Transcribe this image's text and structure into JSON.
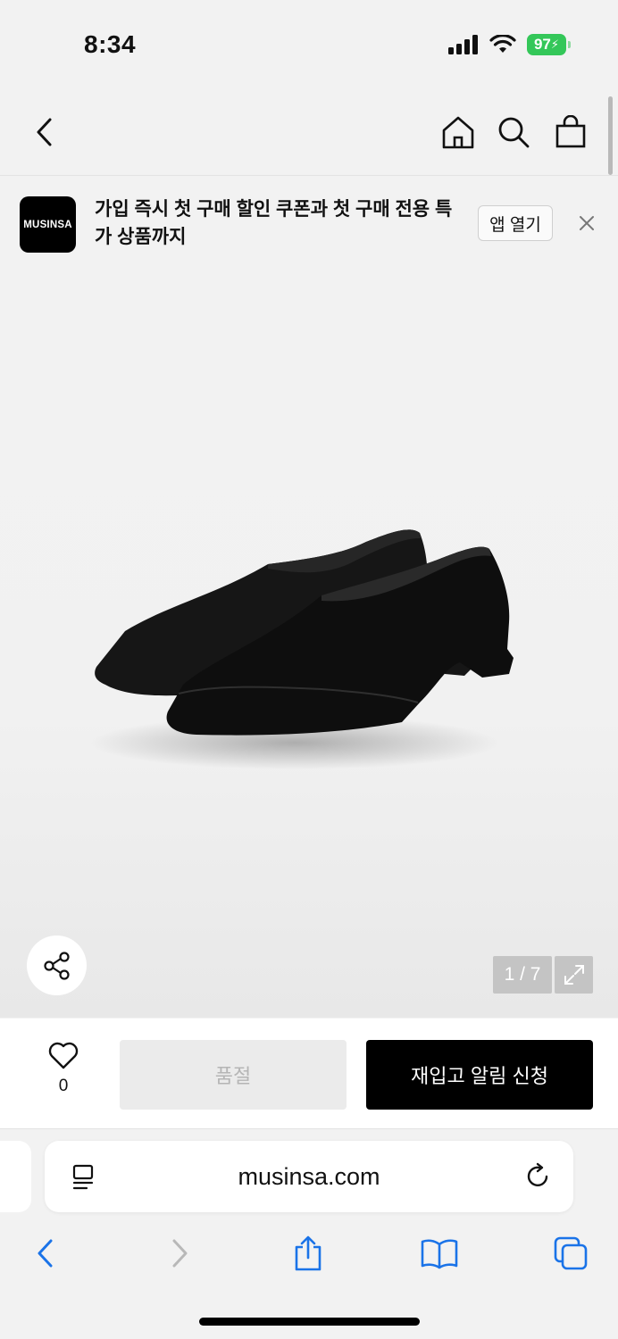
{
  "status_bar": {
    "time": "8:34",
    "battery": "97"
  },
  "banner": {
    "logo_text": "MUSINSA",
    "message_line1": "가입 즉시 첫 구매 할인 쿠폰과 첫 구매 전용 특",
    "message_line2": "가 상품까지",
    "open_app_label": "앱 열기"
  },
  "gallery": {
    "pager": "1 / 7"
  },
  "purchase_bar": {
    "like_count": "0",
    "soldout_label": "품절",
    "restock_label": "재입고 알림 신청"
  },
  "browser": {
    "url": "musinsa.com"
  },
  "colors": {
    "accent_blue": "#1a73e8",
    "battery_green": "#34c759",
    "cta_black": "#000000"
  }
}
